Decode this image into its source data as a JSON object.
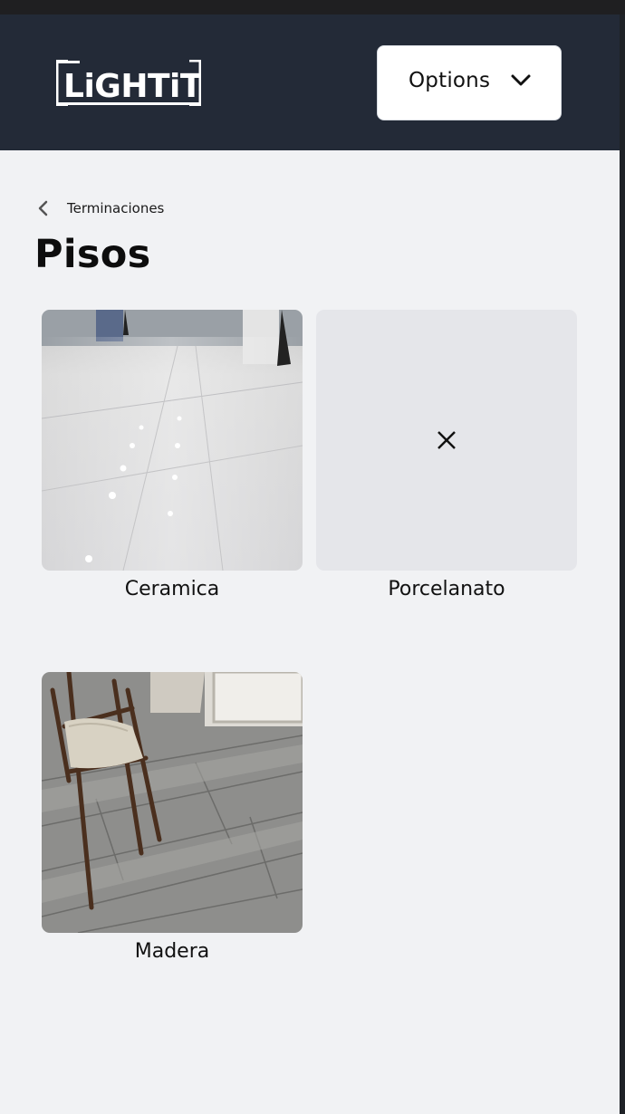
{
  "header": {
    "logo_text": "LiGHTiT",
    "options_label": "Options",
    "options_icon": "chevron-down-icon"
  },
  "breadcrumb": {
    "icon": "chevron-left-icon",
    "label": "Terminaciones"
  },
  "page": {
    "title": "Pisos"
  },
  "items": [
    {
      "label": "Ceramica",
      "image": "polished marble floor photo"
    },
    {
      "label": "Porcelanato",
      "image": "missing-image-icon"
    },
    {
      "label": "Madera",
      "image": "wood plank floor with chair photo"
    }
  ],
  "colors": {
    "header_bg": "#232a37",
    "page_bg": "#f1f2f4",
    "placeholder_bg": "#e5e6ea"
  }
}
